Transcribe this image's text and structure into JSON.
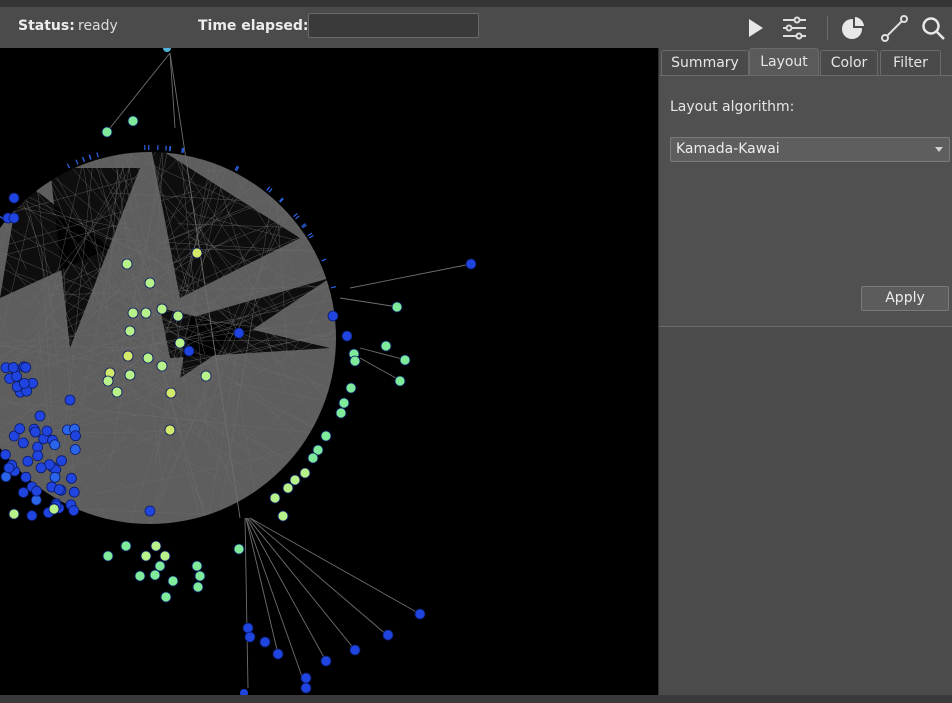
{
  "toolbar": {
    "status_label": "Status:",
    "status_value": "ready",
    "time_label": "Time elapsed:",
    "time_value": "",
    "icons": [
      "play-icon",
      "sliders-icon",
      "pie-chart-icon",
      "edge-line-icon",
      "search-icon"
    ]
  },
  "panel": {
    "tabs": [
      {
        "label": "Summary",
        "active": false
      },
      {
        "label": "Layout",
        "active": true
      },
      {
        "label": "Color",
        "active": false
      },
      {
        "label": "Filter",
        "active": false
      }
    ],
    "layout": {
      "algorithm_label": "Layout algorithm:",
      "algorithm_value": "Kamada-Kawai",
      "apply_label": "Apply"
    }
  },
  "graph": {
    "background": "#000000",
    "edge_color": "#6e6e6e",
    "node_colors": [
      "#1f44e0",
      "#2a64e8",
      "#4fb3d9",
      "#7eea9a",
      "#b8f08a",
      "#d4e86a"
    ]
  }
}
